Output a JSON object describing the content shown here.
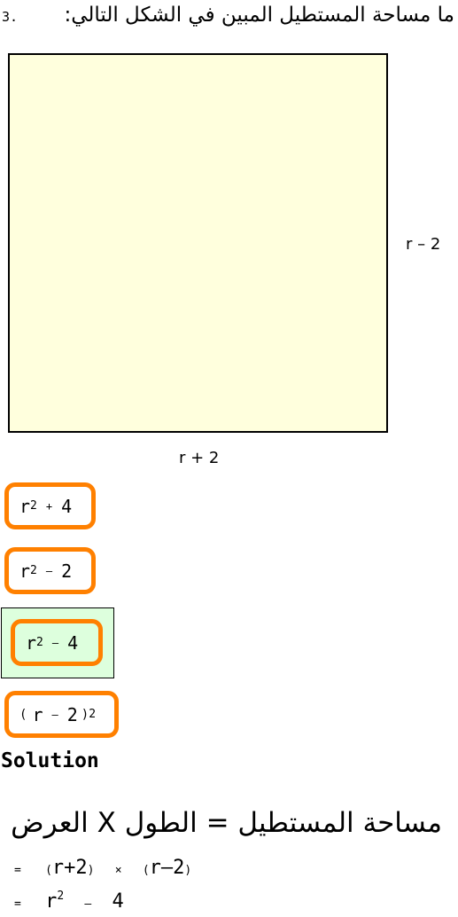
{
  "question": {
    "number": "3.",
    "text": "ما مساحة المستطيل المبين في الشكل التالي:"
  },
  "figure": {
    "fill_color": "#ffffdd",
    "side_label": "r – 2",
    "bottom_label": "r + 2"
  },
  "options": [
    {
      "base": "r",
      "exp": "2",
      "op": "+",
      "rhs": "4",
      "correct": false
    },
    {
      "base": "r",
      "exp": "2",
      "op": "–",
      "rhs": "2",
      "correct": false
    },
    {
      "base": "r",
      "exp": "2",
      "op": "–",
      "rhs": "4",
      "correct": true
    },
    {
      "lparen": "(",
      "base": "r",
      "op": "–",
      "rhs": "2",
      "rparen": ")",
      "exp": "2",
      "correct": false
    }
  ],
  "solution": {
    "title": "Solution",
    "formula": "مساحة المستطيل = الطول X العرض",
    "step1": {
      "eq": "=",
      "lp1": "(",
      "a": "r+2",
      "rp1": ")",
      "times": "×",
      "lp2": "(",
      "b": "r–2",
      "rp2": ")"
    },
    "step2": {
      "eq": "=",
      "base": "r",
      "exp": "2",
      "op": "–",
      "rhs": "4"
    }
  },
  "colors": {
    "option_border": "#ff8000",
    "correct_bg": "#ddffdd"
  }
}
